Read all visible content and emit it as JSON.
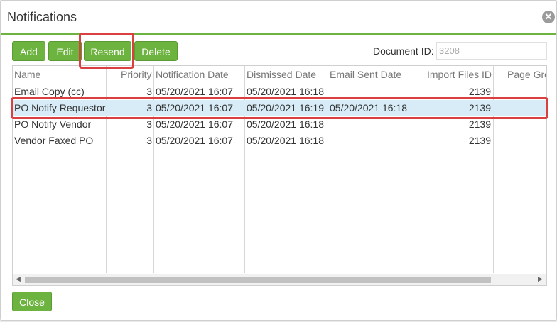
{
  "dialog": {
    "title": "Notifications",
    "close_icon": "close-circle-icon"
  },
  "toolbar": {
    "add": "Add",
    "edit": "Edit",
    "resend": "Resend",
    "delete": "Delete"
  },
  "document": {
    "label": "Document ID:",
    "placeholder": "3208"
  },
  "grid": {
    "columns": [
      "Name",
      "Priority",
      "Notification Date",
      "Dismissed Date",
      "Email Sent Date",
      "Import Files ID",
      "Page Gro"
    ],
    "rows": [
      {
        "name": "Email Copy (cc)",
        "priority": "3",
        "notification_date": "05/20/2021 16:07",
        "dismissed_date": "05/20/2021 16:18",
        "email_sent_date": "",
        "import_files_id": "2139"
      },
      {
        "name": "PO Notify Requestor",
        "priority": "3",
        "notification_date": "05/20/2021 16:07",
        "dismissed_date": "05/20/2021 16:19",
        "email_sent_date": "05/20/2021 16:18",
        "import_files_id": "2139"
      },
      {
        "name": "PO Notify Vendor",
        "priority": "3",
        "notification_date": "05/20/2021 16:07",
        "dismissed_date": "05/20/2021 16:18",
        "email_sent_date": "",
        "import_files_id": "2139"
      },
      {
        "name": "Vendor Faxed PO",
        "priority": "3",
        "notification_date": "05/20/2021 16:07",
        "dismissed_date": "05/20/2021 16:18",
        "email_sent_date": "",
        "import_files_id": "2139"
      }
    ],
    "selected_row": 1
  },
  "footer": {
    "close": "Close"
  },
  "colors": {
    "accent": "#6db33f",
    "highlight": "#d9403f",
    "selected_row": "#d7ecf7"
  }
}
